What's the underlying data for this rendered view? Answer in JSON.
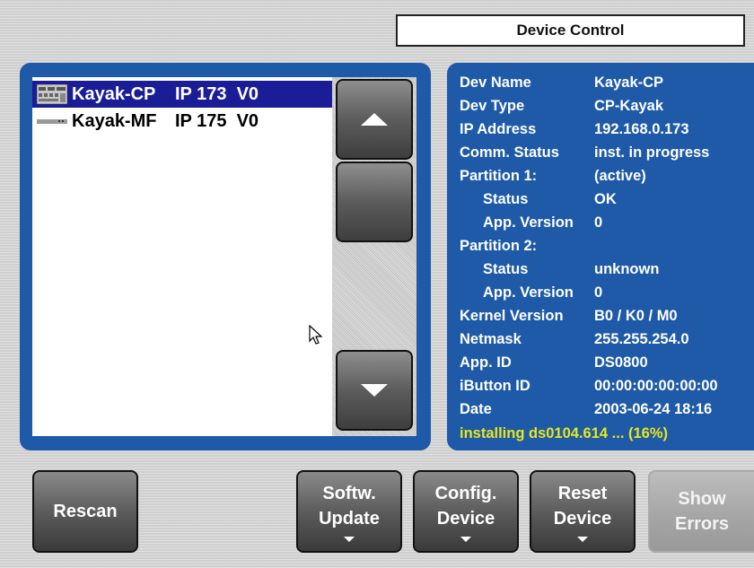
{
  "header": {
    "title": "Device Control"
  },
  "device_list": [
    {
      "name": "Kayak-CP",
      "ip": "IP 173  V0",
      "icon": "panel-device-icon",
      "selected": true
    },
    {
      "name": "Kayak-MF",
      "ip": "IP 175  V0",
      "icon": "mainframe-device-icon",
      "selected": false
    }
  ],
  "scroll": {
    "up_icon": "arrow-up-icon",
    "down_icon": "arrow-down-icon"
  },
  "info": {
    "rows": [
      {
        "label": "Dev Name",
        "value": "Kayak-CP",
        "indent": false
      },
      {
        "label": "Dev Type",
        "value": "CP-Kayak",
        "indent": false
      },
      {
        "label": "IP Address",
        "value": "192.168.0.173",
        "indent": false
      },
      {
        "label": "Comm. Status",
        "value": "inst. in progress",
        "indent": false
      },
      {
        "label": "Partition 1:",
        "value": "(active)",
        "indent": false
      },
      {
        "label": "Status",
        "value": "OK",
        "indent": true
      },
      {
        "label": "App. Version",
        "value": "0",
        "indent": true
      },
      {
        "label": "Partition 2:",
        "value": "",
        "indent": false
      },
      {
        "label": "Status",
        "value": "unknown",
        "indent": true
      },
      {
        "label": "App. Version",
        "value": "0",
        "indent": true
      },
      {
        "label": "Kernel Version",
        "value": "B0 / K0 / M0",
        "indent": false
      },
      {
        "label": "Netmask",
        "value": "255.255.254.0",
        "indent": false
      },
      {
        "label": "App. ID",
        "value": "DS0800",
        "indent": false
      },
      {
        "label": "iButton ID",
        "value": "00:00:00:00:00:00",
        "indent": false
      },
      {
        "label": "Date",
        "value": "2003-06-24  18:16",
        "indent": false
      }
    ],
    "status_line": "installing ds0104.614 ... (16%)"
  },
  "buttons": {
    "rescan": "Rescan",
    "softw_update": [
      "Softw.",
      "Update"
    ],
    "config_device": [
      "Config.",
      "Device"
    ],
    "reset_device": [
      "Reset",
      "Device"
    ],
    "show_errors": [
      "Show",
      "Errors"
    ]
  },
  "colors": {
    "panel_blue": "#1e5aa8",
    "selection": "#1a1d96",
    "status_yellow": "#e8e81a"
  }
}
